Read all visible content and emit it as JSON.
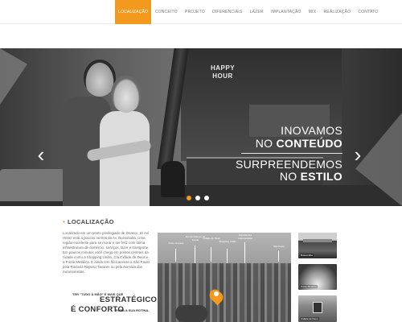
{
  "nav": {
    "items": [
      {
        "label": "LOCALIZAÇÃO",
        "active": true
      },
      {
        "label": "CONCEITO"
      },
      {
        "label": "PROJETO"
      },
      {
        "label": "DIFERENCIAIS"
      },
      {
        "label": "LAZER"
      },
      {
        "label": "IMPLANTAÇÃO"
      },
      {
        "label": "MIX"
      },
      {
        "label": "REALIZAÇÃO"
      },
      {
        "label": "CONTATO"
      }
    ]
  },
  "hero": {
    "neon_line1": "HAPPY",
    "neon_line2": "HOUR",
    "line1": "INOVAMOS",
    "line2_prefix": "NO ",
    "line2_bold": "CONTEÚDO",
    "line3": "SURPREENDEMOS",
    "line4_prefix": "NO ",
    "line4_bold": "ESTILO",
    "prev": "‹",
    "next": "›",
    "dots": [
      true,
      false,
      false
    ]
  },
  "location": {
    "title": "LOCALIZAÇÃO",
    "text": "Localizado em um ponto privilegiado de Osasco, Di Avì Home está a poucos metros da Av. Bussocaba. Uma região excelente para se morar e ser feliz com ótima infraestrutura de comércio, serviços, lazer e transporte. Em poucos minutos você chega em pontos centrais da cidade como o Shopping União, Cia Cidade de Deus e a Ponte Metálica. E ainda tem fácil acesso a São Paulo pela Rodovia Raposo Tavares ou pela Avenida dos Autonomistas.",
    "quote_small1": "TER \"TUDO À MÃO\" É MAIS QUE",
    "quote_big1": "ESTRATÉGICO,",
    "quote_big2": "É CONFORTO",
    "quote_small2": "PARA A SUA ROTINA."
  },
  "map": {
    "labels": [
      "Rodo Ananias",
      "Escola Raposo do Funtal",
      "Cidade de Deus",
      "Shopping União",
      "Avenida dos Autonomistas",
      "São Paulo"
    ]
  },
  "thumbs": [
    "Bussocaba",
    "Ponte Metálica",
    "Cidade de Deus"
  ],
  "colors": {
    "accent": "#f39a1e"
  }
}
